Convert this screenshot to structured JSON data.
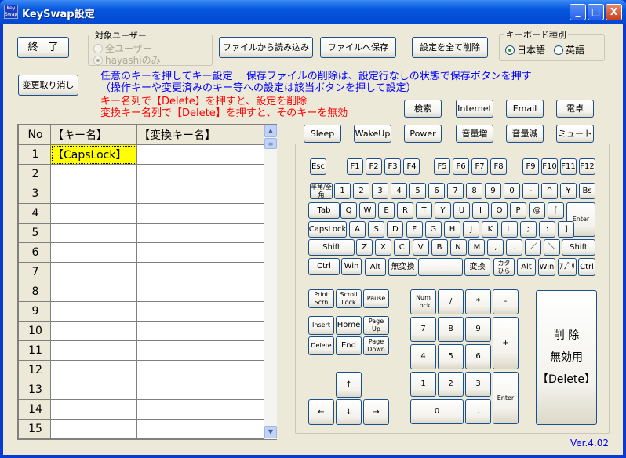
{
  "window": {
    "title": "KeySwap設定",
    "icon_text": "Key Swap",
    "minimize": "_",
    "maximize": "□",
    "close": "X"
  },
  "toolbar": {
    "exit": "終　了",
    "load": "ファイルから読み込み",
    "save": "ファイルへ保存",
    "delete_all": "設定を全て削除",
    "undo": "変更取り消し"
  },
  "target_user": {
    "label": "対象ユーザー",
    "options": [
      "全ユーザー",
      "hayashiのみ"
    ],
    "selected": 1,
    "enabled": false
  },
  "keyboard_type": {
    "label": "キーボード種別",
    "options": [
      "日本語",
      "英語"
    ],
    "selected": 0
  },
  "messages": {
    "blue": [
      "任意のキーを押してキー設定　 保存ファイルの削除は、設定行なしの状態で保存ボタンを押す",
      "（操作キーや変更済みのキー等への設定は該当ボタンを押して設定）"
    ],
    "red": [
      "キー名列で【Delete】を押すと、設定を削除",
      "変換キー名列で【Delete】を押すと、そのキーを無効"
    ]
  },
  "special_keys": [
    "検索",
    "Internet",
    "Email",
    "電卓",
    "Sleep",
    "WakeUp",
    "Power",
    "音量増",
    "音量減",
    "ミュート"
  ],
  "grid": {
    "headers": [
      "No",
      "【キー名】",
      "【変換キー名】"
    ],
    "rows": [
      {
        "no": "1",
        "key": "【CapsLock】",
        "to": ""
      },
      {
        "no": "2",
        "key": "",
        "to": ""
      },
      {
        "no": "3",
        "key": "",
        "to": ""
      },
      {
        "no": "4",
        "key": "",
        "to": ""
      },
      {
        "no": "5",
        "key": "",
        "to": ""
      },
      {
        "no": "6",
        "key": "",
        "to": ""
      },
      {
        "no": "7",
        "key": "",
        "to": ""
      },
      {
        "no": "8",
        "key": "",
        "to": ""
      },
      {
        "no": "9",
        "key": "",
        "to": ""
      },
      {
        "no": "10",
        "key": "",
        "to": ""
      },
      {
        "no": "11",
        "key": "",
        "to": ""
      },
      {
        "no": "12",
        "key": "",
        "to": ""
      },
      {
        "no": "13",
        "key": "",
        "to": ""
      },
      {
        "no": "14",
        "key": "",
        "to": ""
      },
      {
        "no": "15",
        "key": "",
        "to": ""
      }
    ]
  },
  "keyboard": {
    "keys": [
      "Esc",
      "F1",
      "F2",
      "F3",
      "F4",
      "F5",
      "F6",
      "F7",
      "F8",
      "F9",
      "F10",
      "F11",
      "F12",
      "半角/全角",
      "1",
      "2",
      "3",
      "4",
      "5",
      "6",
      "7",
      "8",
      "9",
      "0",
      "-",
      "^",
      "¥",
      "Bs",
      "Tab",
      "Q",
      "W",
      "E",
      "R",
      "T",
      "Y",
      "U",
      "I",
      "O",
      "P",
      "@",
      "[",
      "Enter",
      "CapsLock",
      "A",
      "S",
      "D",
      "F",
      "G",
      "H",
      "J",
      "K",
      "L",
      ";",
      ":",
      "]",
      "Shift",
      "Z",
      "X",
      "C",
      "V",
      "B",
      "N",
      "M",
      ",",
      ".",
      "／",
      "＼",
      "Shift",
      "Ctrl",
      "Win",
      "Alt",
      "無変換",
      "",
      "変換",
      "カタ ひら",
      "Alt",
      "Win",
      "ｱﾌﾟﾘ",
      "Ctrl",
      "Print Scrn",
      "Scroll Lock",
      "Pause",
      "Insert",
      "Home",
      "Page Up",
      "Delete",
      "End",
      "Page Down",
      "↑",
      "←",
      "↓",
      "→",
      "Num Lock",
      "/",
      "*",
      "-",
      "7",
      "8",
      "9",
      "+",
      "4",
      "5",
      "6",
      "1",
      "2",
      "3",
      "Enter",
      "0",
      "."
    ],
    "delete_disable": [
      "削 除",
      "無効用",
      "【Delete】"
    ]
  },
  "version": "Ver.4.02"
}
